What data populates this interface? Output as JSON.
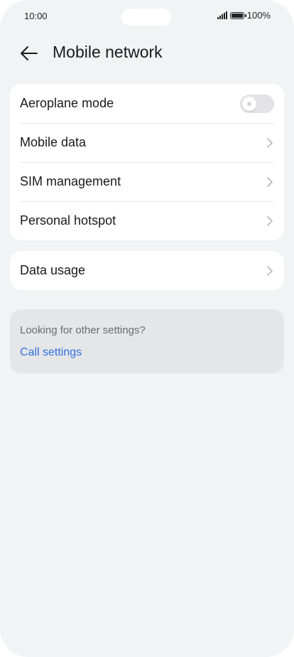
{
  "status_bar": {
    "time": "10:00",
    "battery": "100%"
  },
  "header": {
    "title": "Mobile network",
    "back_icon": "arrow-left-icon"
  },
  "main_card": {
    "items": [
      {
        "label": "Aeroplane mode",
        "control": "toggle",
        "on": false
      },
      {
        "label": "Mobile data",
        "control": "chevron"
      },
      {
        "label": "SIM management",
        "control": "chevron"
      },
      {
        "label": "Personal hotspot",
        "control": "chevron"
      }
    ]
  },
  "usage_card": {
    "items": [
      {
        "label": "Data usage",
        "control": "chevron"
      }
    ]
  },
  "info": {
    "text": "Looking for other settings?",
    "link": "Call settings"
  },
  "colors": {
    "background": "#f1f3f5",
    "card": "#ffffff",
    "link": "#2f6fde"
  }
}
